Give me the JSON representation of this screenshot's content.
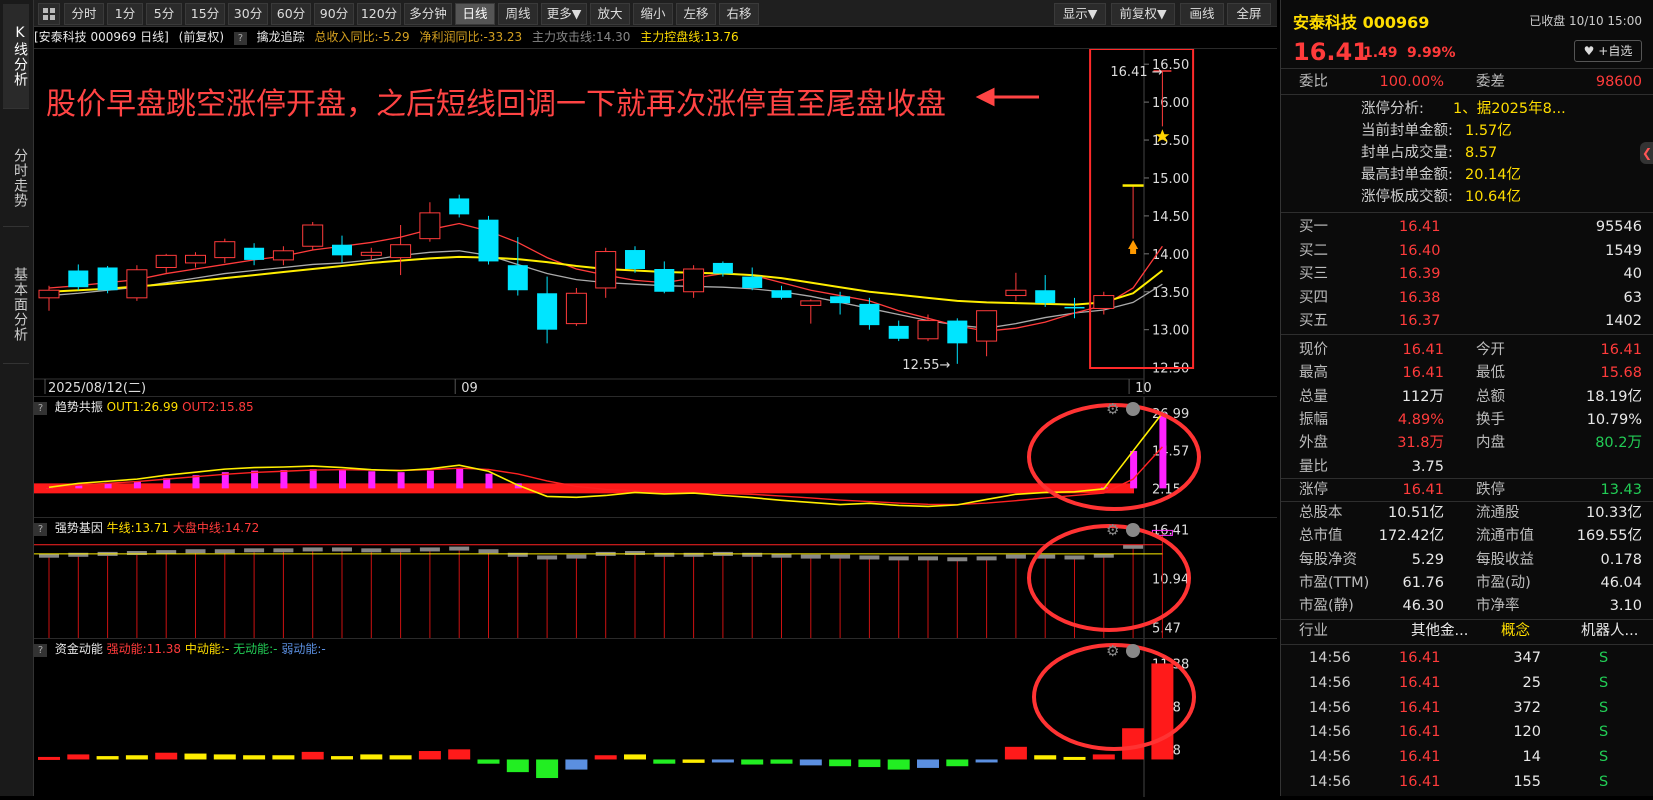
{
  "left_tabs": [
    "K线分析",
    "分时走势",
    "基本面分析"
  ],
  "toolbar": {
    "grid_icon": "grid-icon",
    "buttons": [
      "分时",
      "1分",
      "5分",
      "15分",
      "30分",
      "60分",
      "90分",
      "120分",
      "多分钟",
      "日线",
      "周线",
      "更多▼",
      "放大",
      "缩小",
      "左移",
      "右移"
    ],
    "active": "日线",
    "right_buttons": [
      "显示▼",
      "前复权▼",
      "画线",
      "全屏"
    ]
  },
  "info": {
    "stock": "[安泰科技 000969 日线]",
    "adjust": "(前复权)",
    "indicator": "擒龙追踪",
    "rev": "总收入同比:-5.29",
    "profit": "净利润同比:-33.23",
    "attack": "主力攻击线:14.30",
    "control": "主力控盘线:13.76"
  },
  "colors": {
    "up": "#ff3b3b",
    "down": "#00e5ff",
    "ma5": "#ff3b3b",
    "ma10": "#ffee00",
    "ma20": "#aaaaaa"
  },
  "annotation": "股价早盘跳空涨停开盘，之后短线回调一下就再次涨停直至尾盘收盘",
  "chart_data": [
    {
      "type": "candlestick",
      "yticks": [
        "16.50",
        "16.00",
        "15.50",
        "15.00",
        "14.50",
        "14.00",
        "13.50",
        "13.00",
        "12.50"
      ],
      "ylim": [
        12.35,
        16.7
      ],
      "x_labels": [
        {
          "text": "2025/08/12(二)",
          "index": 0
        },
        {
          "text": "09",
          "index": 14
        },
        {
          "text": "10",
          "index": 37
        }
      ],
      "high_label": "16.41",
      "low_label": "12.55",
      "ohlc": [
        [
          13.42,
          13.58,
          13.25,
          13.52
        ],
        [
          13.78,
          13.86,
          13.52,
          13.56
        ],
        [
          13.82,
          13.84,
          13.48,
          13.52
        ],
        [
          13.42,
          13.85,
          13.38,
          13.79
        ],
        [
          13.82,
          14.0,
          13.75,
          13.98
        ],
        [
          13.88,
          14.02,
          13.82,
          13.98
        ],
        [
          13.95,
          14.2,
          13.88,
          14.16
        ],
        [
          14.08,
          14.14,
          13.85,
          13.92
        ],
        [
          13.92,
          14.1,
          13.85,
          14.04
        ],
        [
          14.1,
          14.42,
          14.05,
          14.38
        ],
        [
          14.12,
          14.24,
          13.88,
          13.98
        ],
        [
          13.98,
          14.08,
          13.92,
          14.02
        ],
        [
          13.95,
          14.38,
          13.72,
          14.12
        ],
        [
          14.2,
          14.68,
          14.16,
          14.54
        ],
        [
          14.73,
          14.78,
          14.48,
          14.52
        ],
        [
          14.45,
          14.5,
          13.86,
          13.9
        ],
        [
          13.85,
          14.22,
          13.45,
          13.52
        ],
        [
          13.48,
          13.7,
          12.82,
          13.0
        ],
        [
          13.08,
          13.55,
          13.05,
          13.48
        ],
        [
          13.55,
          14.08,
          13.42,
          14.03
        ],
        [
          14.05,
          14.1,
          13.75,
          13.8
        ],
        [
          13.8,
          13.9,
          13.48,
          13.5
        ],
        [
          13.5,
          13.85,
          13.42,
          13.8
        ],
        [
          13.88,
          13.9,
          13.7,
          13.74
        ],
        [
          13.7,
          13.82,
          13.52,
          13.55
        ],
        [
          13.52,
          13.58,
          13.4,
          13.42
        ],
        [
          13.32,
          13.4,
          13.08,
          13.38
        ],
        [
          13.44,
          13.5,
          13.2,
          13.35
        ],
        [
          13.34,
          13.42,
          13.0,
          13.06
        ],
        [
          13.05,
          13.12,
          12.85,
          12.88
        ],
        [
          12.88,
          13.2,
          12.85,
          13.12
        ],
        [
          13.12,
          13.15,
          12.55,
          12.82
        ],
        [
          12.85,
          13.2,
          12.65,
          13.25
        ],
        [
          13.45,
          13.75,
          13.38,
          13.52
        ],
        [
          13.52,
          13.72,
          13.3,
          13.35
        ],
        [
          13.3,
          13.42,
          13.15,
          13.28
        ],
        [
          13.28,
          13.5,
          13.2,
          13.45
        ],
        [
          14.91,
          14.91,
          14.2,
          14.91
        ],
        [
          16.41,
          16.41,
          15.68,
          16.41
        ]
      ],
      "ma": {
        "ma5": [
          13.55,
          13.58,
          13.62,
          13.66,
          13.74,
          13.8,
          13.86,
          13.92,
          13.97,
          14.05,
          14.1,
          14.15,
          14.22,
          14.32,
          14.4,
          14.3,
          14.15,
          13.95,
          13.8,
          13.72,
          13.65,
          13.62,
          13.68,
          13.74,
          13.72,
          13.62,
          13.52,
          13.45,
          13.38,
          13.25,
          13.15,
          13.05,
          12.98,
          13.02,
          13.1,
          13.22,
          13.32,
          13.55,
          14.1
        ],
        "ma10": [
          13.5,
          13.52,
          13.54,
          13.57,
          13.6,
          13.64,
          13.68,
          13.72,
          13.76,
          13.8,
          13.84,
          13.88,
          13.91,
          13.94,
          13.96,
          13.95,
          13.93,
          13.89,
          13.84,
          13.8,
          13.78,
          13.76,
          13.75,
          13.74,
          13.72,
          13.68,
          13.62,
          13.56,
          13.5,
          13.46,
          13.42,
          13.38,
          13.36,
          13.35,
          13.34,
          13.33,
          13.36,
          13.48,
          13.78
        ],
        "ma20": [
          13.45,
          13.48,
          13.52,
          13.56,
          13.62,
          13.68,
          13.74,
          13.78,
          13.82,
          13.86,
          13.88,
          13.92,
          13.98,
          14.02,
          14.04,
          13.98,
          13.86,
          13.74,
          13.66,
          13.62,
          13.6,
          13.58,
          13.57,
          13.56,
          13.54,
          13.5,
          13.44,
          13.36,
          13.28,
          13.2,
          13.12,
          13.06,
          13.02,
          13.08,
          13.16,
          13.22,
          13.26,
          13.36,
          13.6
        ]
      },
      "star_price": 15.55
    },
    {
      "type": "bar",
      "title": "趋势共振",
      "legend": [
        "OUT1:26.99",
        "OUT2:15.85"
      ],
      "yticks": [
        "26.99",
        "14.57",
        "2.15"
      ],
      "ylim": [
        -4,
        29
      ],
      "bars": [
        2.2,
        3.5,
        4.0,
        4.5,
        5.5,
        6.5,
        7.5,
        8.0,
        8.2,
        8.5,
        8.4,
        7.8,
        7.5,
        8.0,
        8.8,
        7.0,
        3.8,
        0,
        0,
        0,
        0,
        0,
        0,
        0,
        0,
        0,
        0,
        0,
        0,
        0,
        0,
        0,
        0,
        0,
        0,
        0,
        2.5,
        14.5,
        26.99
      ],
      "out1": [
        2.5,
        3.8,
        4.5,
        5.2,
        6.5,
        7.5,
        8.5,
        9.0,
        9.2,
        9.5,
        9.0,
        8.3,
        8.0,
        8.6,
        9.8,
        7.8,
        3.2,
        -0.5,
        -0.8,
        -0.2,
        0.8,
        0.3,
        0.6,
        -0.2,
        -0.9,
        -1.8,
        -2.5,
        -3.2,
        -2.8,
        -3.5,
        -3.8,
        -3.3,
        -1.5,
        0.2,
        0.8,
        1.0,
        2.0,
        14.5,
        26.99
      ],
      "out2": [
        2.5,
        3.2,
        3.8,
        4.4,
        5.2,
        6.0,
        6.8,
        7.4,
        7.8,
        8.2,
        8.3,
        8.2,
        8.1,
        8.3,
        8.8,
        8.4,
        6.9,
        4.6,
        2.8,
        1.8,
        1.4,
        1.0,
        0.8,
        0.5,
        0.2,
        -0.4,
        -1.0,
        -1.7,
        -2.2,
        -2.7,
        -3.1,
        -3.2,
        -2.7,
        -1.9,
        -1.0,
        -0.2,
        0.6,
        5.2,
        15.85
      ]
    },
    {
      "type": "bar",
      "title": "强势基因",
      "legend": [
        "牛线:13.71",
        "大盘中线:14.72"
      ],
      "yticks": [
        "16.41",
        "10.94",
        "5.47"
      ],
      "ylim": [
        4.5,
        17.5
      ],
      "blocks": [
        13.5,
        13.6,
        13.7,
        13.8,
        13.9,
        14.0,
        14.0,
        14.1,
        14.1,
        14.2,
        14.2,
        14.1,
        14.1,
        14.2,
        14.3,
        14.0,
        13.6,
        13.3,
        13.4,
        13.7,
        13.8,
        13.6,
        13.6,
        13.7,
        13.6,
        13.5,
        13.4,
        13.4,
        13.3,
        13.2,
        13.2,
        13.1,
        13.2,
        13.4,
        13.4,
        13.3,
        13.5,
        14.5,
        16.0
      ],
      "bull": 13.71,
      "mid": 14.72
    },
    {
      "type": "bar",
      "title": "资金动能",
      "legend": [
        "强动能:11.38",
        "中动能:-",
        "无动能:-",
        "弱动能:-"
      ],
      "yticks": [
        "11.38",
        "6.28",
        "1.18"
      ],
      "ylim": [
        -3.5,
        12.5
      ],
      "values": [
        0.3,
        0.6,
        0.4,
        0.5,
        0.8,
        0.7,
        0.6,
        0.5,
        0.5,
        0.9,
        0.4,
        0.6,
        0.5,
        1.0,
        1.2,
        -0.5,
        -1.5,
        -2.2,
        -1.2,
        0.5,
        0.6,
        -0.5,
        -0.4,
        -0.3,
        -0.6,
        -0.5,
        -0.7,
        -0.8,
        -0.9,
        -1.2,
        -1.0,
        -0.8,
        -0.2,
        1.5,
        0.5,
        0.3,
        0.6,
        3.7,
        11.38
      ],
      "cats": [
        "r",
        "r",
        "y",
        "y",
        "r",
        "y",
        "y",
        "y",
        "y",
        "r",
        "y",
        "y",
        "y",
        "r",
        "r",
        "g",
        "g",
        "g",
        "b",
        "r",
        "y",
        "g",
        "y",
        "b",
        "g",
        "g",
        "b",
        "g",
        "g",
        "g",
        "b",
        "g",
        "b",
        "r",
        "y",
        "y",
        "r",
        "r",
        "r"
      ]
    }
  ],
  "quote": {
    "name": "安泰科技 000969",
    "status": "已收盘 10/10 15:00",
    "price": "16.41",
    "change": "1.49",
    "pct": "9.99%",
    "fav": "+自选",
    "weibi_l": "委比",
    "weibi": "100.00%",
    "weicha_l": "委差",
    "weicha": "98600",
    "limit_info": [
      [
        "涨停分析:",
        "1、据2025年8..."
      ],
      [
        "当前封单金额:",
        "1.57亿"
      ],
      [
        "封单占成交量:",
        "8.57"
      ],
      [
        "最高封单金额:",
        "20.14亿"
      ],
      [
        "涨停板成交额:",
        "10.64亿"
      ]
    ],
    "bids": [
      [
        "买一",
        "16.41",
        "95546"
      ],
      [
        "买二",
        "16.40",
        "1549"
      ],
      [
        "买三",
        "16.39",
        "40"
      ],
      [
        "买四",
        "16.38",
        "63"
      ],
      [
        "买五",
        "16.37",
        "1402"
      ]
    ],
    "stats": [
      [
        "现价",
        "16.41",
        "r",
        "今开",
        "16.41",
        "r"
      ],
      [
        "最高",
        "16.41",
        "r",
        "最低",
        "15.68",
        "r"
      ],
      [
        "总量",
        "112万",
        "w",
        "总额",
        "18.19亿",
        "w"
      ],
      [
        "振幅",
        "4.89%",
        "r",
        "换手",
        "10.79%",
        "w"
      ],
      [
        "外盘",
        "31.8万",
        "r",
        "内盘",
        "80.2万",
        "g"
      ],
      [
        "量比",
        "3.75",
        "w",
        "",
        "",
        ""
      ],
      [
        "涨停",
        "16.41",
        "r",
        "跌停",
        "13.43",
        "g"
      ],
      [
        "总股本",
        "10.51亿",
        "w",
        "流通股",
        "10.33亿",
        "w"
      ],
      [
        "总市值",
        "172.42亿",
        "w",
        "流通市值",
        "169.55亿",
        "w"
      ],
      [
        "每股净资",
        "5.29",
        "w",
        "每股收益",
        "0.178",
        "w"
      ],
      [
        "市盈(TTM)",
        "61.76",
        "w",
        "市盈(动)",
        "46.04",
        "w"
      ],
      [
        "市盈(静)",
        "46.30",
        "w",
        "市净率",
        "3.10",
        "w"
      ]
    ],
    "industry": [
      "行业",
      "其他金...",
      "概念",
      "机器人..."
    ],
    "ticks": [
      [
        "14:56",
        "16.41",
        "347",
        "S"
      ],
      [
        "14:56",
        "16.41",
        "25",
        "S"
      ],
      [
        "14:56",
        "16.41",
        "372",
        "S"
      ],
      [
        "14:56",
        "16.41",
        "120",
        "S"
      ],
      [
        "14:56",
        "16.41",
        "14",
        "S"
      ],
      [
        "14:56",
        "16.41",
        "155",
        "S"
      ]
    ]
  }
}
